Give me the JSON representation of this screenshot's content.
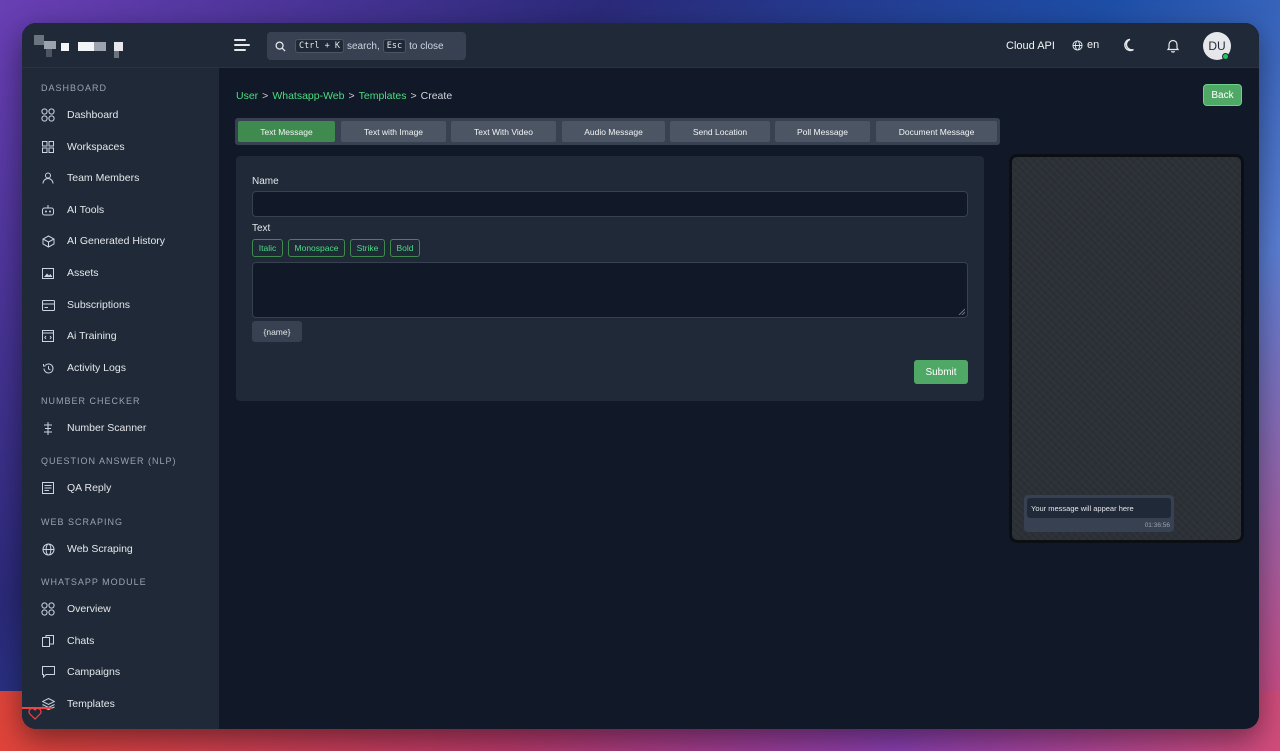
{
  "topbar": {
    "search_kbd_1": "Ctrl + K",
    "search_text_1": "search,",
    "search_kbd_2": "Esc",
    "search_text_2": "to close",
    "cloud_api": "Cloud API",
    "language": "en",
    "avatar_initials": "DU"
  },
  "sidebar": {
    "sections": [
      {
        "label": "DASHBOARD",
        "items": [
          "Dashboard",
          "Workspaces",
          "Team Members",
          "AI Tools",
          "AI Generated History",
          "Assets",
          "Subscriptions",
          "Ai Training",
          "Activity Logs"
        ]
      },
      {
        "label": "NUMBER CHECKER",
        "items": [
          "Number Scanner"
        ]
      },
      {
        "label": "QUESTION ANSWER (NLP)",
        "items": [
          "QA Reply"
        ]
      },
      {
        "label": "WEB SCRAPING",
        "items": [
          "Web Scraping"
        ]
      },
      {
        "label": "WHATSAPP MODULE",
        "items": [
          "Overview",
          "Chats",
          "Campaigns",
          "Templates"
        ]
      }
    ]
  },
  "breadcrumb": {
    "items": [
      "User",
      "Whatsapp-Web",
      "Templates"
    ],
    "current": "Create",
    "separator": ">"
  },
  "back_label": "Back",
  "tabs": [
    "Text Message",
    "Text with Image",
    "Text With Video",
    "Audio Message",
    "Send Location",
    "Poll Message",
    "Document Message"
  ],
  "active_tab": "Text Message",
  "form": {
    "name_label": "Name",
    "name_value": "",
    "text_label": "Text",
    "format_buttons": [
      "Italic",
      "Monospace",
      "Strike",
      "Bold"
    ],
    "text_value": "",
    "variable_button": "{name}",
    "submit_label": "Submit"
  },
  "preview": {
    "message": "Your message will appear here",
    "time": "01:36:56"
  },
  "colors": {
    "accent_green": "#4fa865",
    "link_green": "#4ade80",
    "sidebar_bg": "#1f2937",
    "main_bg": "#111827"
  }
}
